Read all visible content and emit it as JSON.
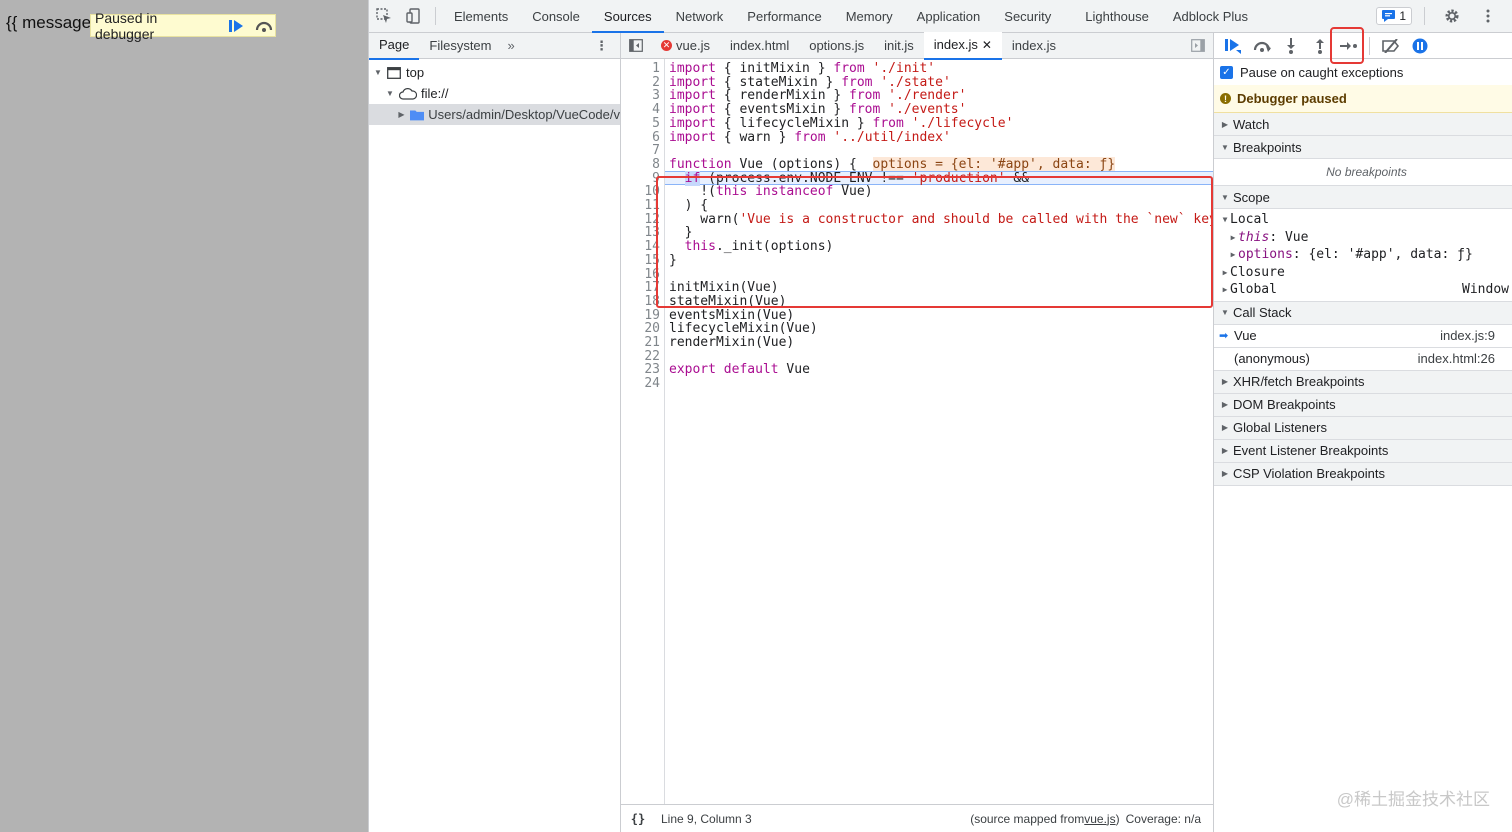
{
  "page": {
    "message": "{{ message",
    "overlay_label": "Paused in debugger"
  },
  "toolbar": {
    "tabs": [
      "Elements",
      "Console",
      "Sources",
      "Network",
      "Performance",
      "Memory",
      "Application",
      "Security",
      "Lighthouse",
      "Adblock Plus"
    ],
    "active_tab": "Sources",
    "issues_count": "1"
  },
  "navigator": {
    "tabs": [
      "Page",
      "Filesystem"
    ],
    "more": "»",
    "tree": [
      {
        "label": "top",
        "icon": "frame-icon",
        "depth": 0
      },
      {
        "label": "file://",
        "icon": "cloud-icon",
        "depth": 1
      },
      {
        "label": "Users/admin/Desktop/VueCode/v",
        "icon": "folder-icon",
        "depth": 2
      }
    ]
  },
  "editor": {
    "tabs": [
      {
        "label": "vue.js",
        "error": true
      },
      {
        "label": "index.html"
      },
      {
        "label": "options.js"
      },
      {
        "label": "init.js"
      },
      {
        "label": "index.js",
        "active": true,
        "closable": true
      },
      {
        "label": "index.js"
      }
    ],
    "inline_value": "options = {el: '#app', data: ƒ}",
    "status": {
      "braces": "{}",
      "position": "Line 9, Column 3",
      "source_mapped_prefix": "(source mapped from ",
      "source_mapped_file": "vue.js",
      "source_mapped_suffix": ")",
      "coverage": "Coverage: n/a"
    }
  },
  "code_lines": [
    "import { initMixin } from './init'",
    "import { stateMixin } from './state'",
    "import { renderMixin } from './render'",
    "import { eventsMixin } from './events'",
    "import { lifecycleMixin } from './lifecycle'",
    "import { warn } from '../util/index'",
    "",
    "function Vue (options) {",
    "  if (process.env.NODE_ENV !== 'production' &&",
    "    !(this instanceof Vue)",
    "  ) {",
    "    warn('Vue is a constructor and should be called with the `new` keyword')",
    "  }",
    "  this._init(options)",
    "}",
    "",
    "initMixin(Vue)",
    "stateMixin(Vue)",
    "eventsMixin(Vue)",
    "lifecycleMixin(Vue)",
    "renderMixin(Vue)",
    "",
    "export default Vue",
    ""
  ],
  "sidebar": {
    "pause_caught": "Pause on caught exceptions",
    "paused_label": "Debugger paused",
    "sections": {
      "watch": "Watch",
      "breakpoints": "Breakpoints",
      "no_breakpoints": "No breakpoints",
      "scope": "Scope",
      "call_stack": "Call Stack",
      "xhr": "XHR/fetch Breakpoints",
      "dom": "DOM Breakpoints",
      "global_listeners": "Global Listeners",
      "event_listener": "Event Listener Breakpoints",
      "csp": "CSP Violation Breakpoints"
    },
    "scope": {
      "local": "Local",
      "this_key": "this",
      "this_val": ": Vue",
      "options_key": "options",
      "options_val": ": {el: '#app', data: ƒ}",
      "closure": "Closure",
      "global": "Global",
      "global_val": "Window"
    },
    "call_stack": [
      {
        "name": "Vue",
        "loc": "index.js:9"
      },
      {
        "name": "(anonymous)",
        "loc": "index.html:26"
      }
    ]
  },
  "watermark": "@稀土掘金技术社区",
  "colors": {
    "accent": "#1a73e8",
    "highlight_box": "#e53935"
  }
}
